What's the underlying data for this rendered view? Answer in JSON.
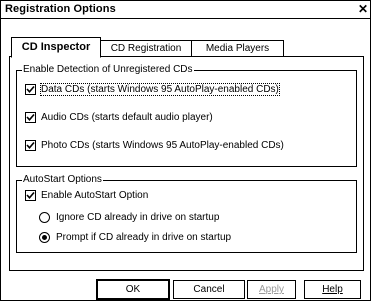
{
  "window": {
    "title": "Registration Options",
    "close_glyph": "✕"
  },
  "tabs": [
    {
      "label": "CD Inspector",
      "active": true
    },
    {
      "label": "CD Registration",
      "active": false
    },
    {
      "label": "Media Players",
      "active": false
    }
  ],
  "detection": {
    "legend": "Enable Detection of Unregistered CDs",
    "options": [
      {
        "label": "Data CDs (starts Windows 95 AutoPlay-enabled CDs)",
        "checked": true
      },
      {
        "label": "Audio CDs (starts default audio player)",
        "checked": true
      },
      {
        "label": "Photo CDs (starts Windows 95 AutoPlay-enabled CDs)",
        "checked": true
      }
    ]
  },
  "autostart": {
    "legend": "AutoStart Options",
    "enable": {
      "label": "Enable AutoStart Option",
      "checked": true
    },
    "radios": [
      {
        "label": "Ignore CD already in drive on startup",
        "selected": false
      },
      {
        "label": "Prompt if CD already in drive on startup",
        "selected": true
      }
    ]
  },
  "buttons": {
    "ok": "OK",
    "cancel": "Cancel",
    "apply": "Apply",
    "help": "Help"
  },
  "icons": {
    "close": "close-icon",
    "check": "checkmark-icon"
  }
}
